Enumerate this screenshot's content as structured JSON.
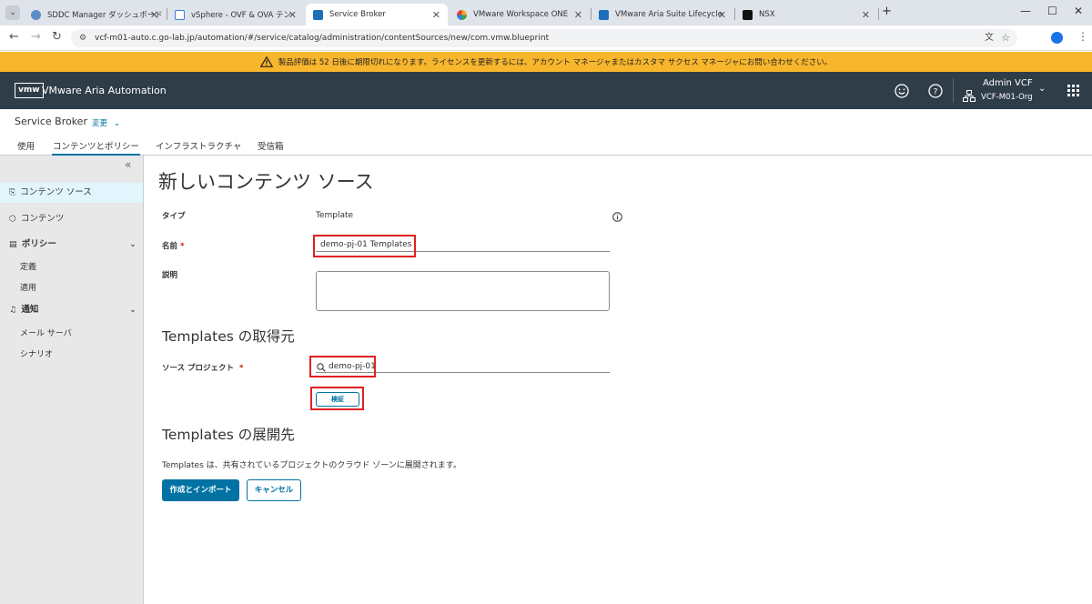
{
  "browser": {
    "tabs": [
      {
        "title": "SDDC Manager ダッシュボード",
        "active": false,
        "icon": "sddc-icon"
      },
      {
        "title": "vSphere - OVF & OVA テンプレート",
        "active": false,
        "icon": "vsphere-icon"
      },
      {
        "title": "Service Broker",
        "active": true,
        "icon": "vmw-icon"
      },
      {
        "title": "VMware Workspace ONE",
        "active": false,
        "icon": "workspace-one-icon"
      },
      {
        "title": "VMware Aria Suite Lifecycle",
        "active": false,
        "icon": "vmw-icon"
      },
      {
        "title": "NSX",
        "active": false,
        "icon": "nsx-icon"
      }
    ],
    "new_tab": "+",
    "url": "vcf-m01-auto.c.go-lab.jp/automation/#/service/catalog/administration/contentSources/new/com.vmw.blueprint"
  },
  "license_banner": "製品評価は 52 日後に期限切れになります。ライセンスを更新するには、アカウント マネージャまたはカスタマ サクセス マネージャにお問い合わせください。",
  "app_header": {
    "logo": "vmw",
    "title": "VMware Aria Automation",
    "user_name": "Admin VCF",
    "org_name": "VCF-M01-Org"
  },
  "service": {
    "name": "Service Broker",
    "change_label": "変更"
  },
  "nav_tabs": [
    "使用",
    "コンテンツとポリシー",
    "インフラストラクチャ",
    "受信箱"
  ],
  "sidebar": {
    "collapse": "«",
    "items": [
      {
        "label": "コンテンツ ソース",
        "icon": "content-source-icon"
      },
      {
        "label": "コンテンツ",
        "icon": "cube-icon"
      },
      {
        "label": "ポリシー",
        "icon": "policy-icon"
      },
      {
        "label": "定義"
      },
      {
        "label": "適用"
      },
      {
        "label": "通知",
        "icon": "bell-icon"
      },
      {
        "label": "メール サーバ"
      },
      {
        "label": "シナリオ"
      }
    ]
  },
  "form": {
    "title": "新しいコンテンツ ソース",
    "type_label": "タイプ",
    "type_value": "Template",
    "name_label": "名前",
    "required_mark": "*",
    "name_value": "demo-pj-01 Templates",
    "description_label": "説明",
    "description_value": "",
    "source_section": "Templates の取得元",
    "source_project_label": "ソース プロジェクト",
    "source_project_value": "demo-pj-01",
    "validate_button": "検証",
    "deploy_section": "Templates の展開先",
    "deploy_text": "Templates は、共有されているプロジェクトのクラウド ゾーンに展開されます。",
    "create_button": "作成とインポート",
    "cancel_button": "キャンセル"
  },
  "colors": {
    "banner": "#f8b62d",
    "header": "#2f3d49",
    "primary": "#0072a3",
    "highlight_box": "#e02020"
  }
}
